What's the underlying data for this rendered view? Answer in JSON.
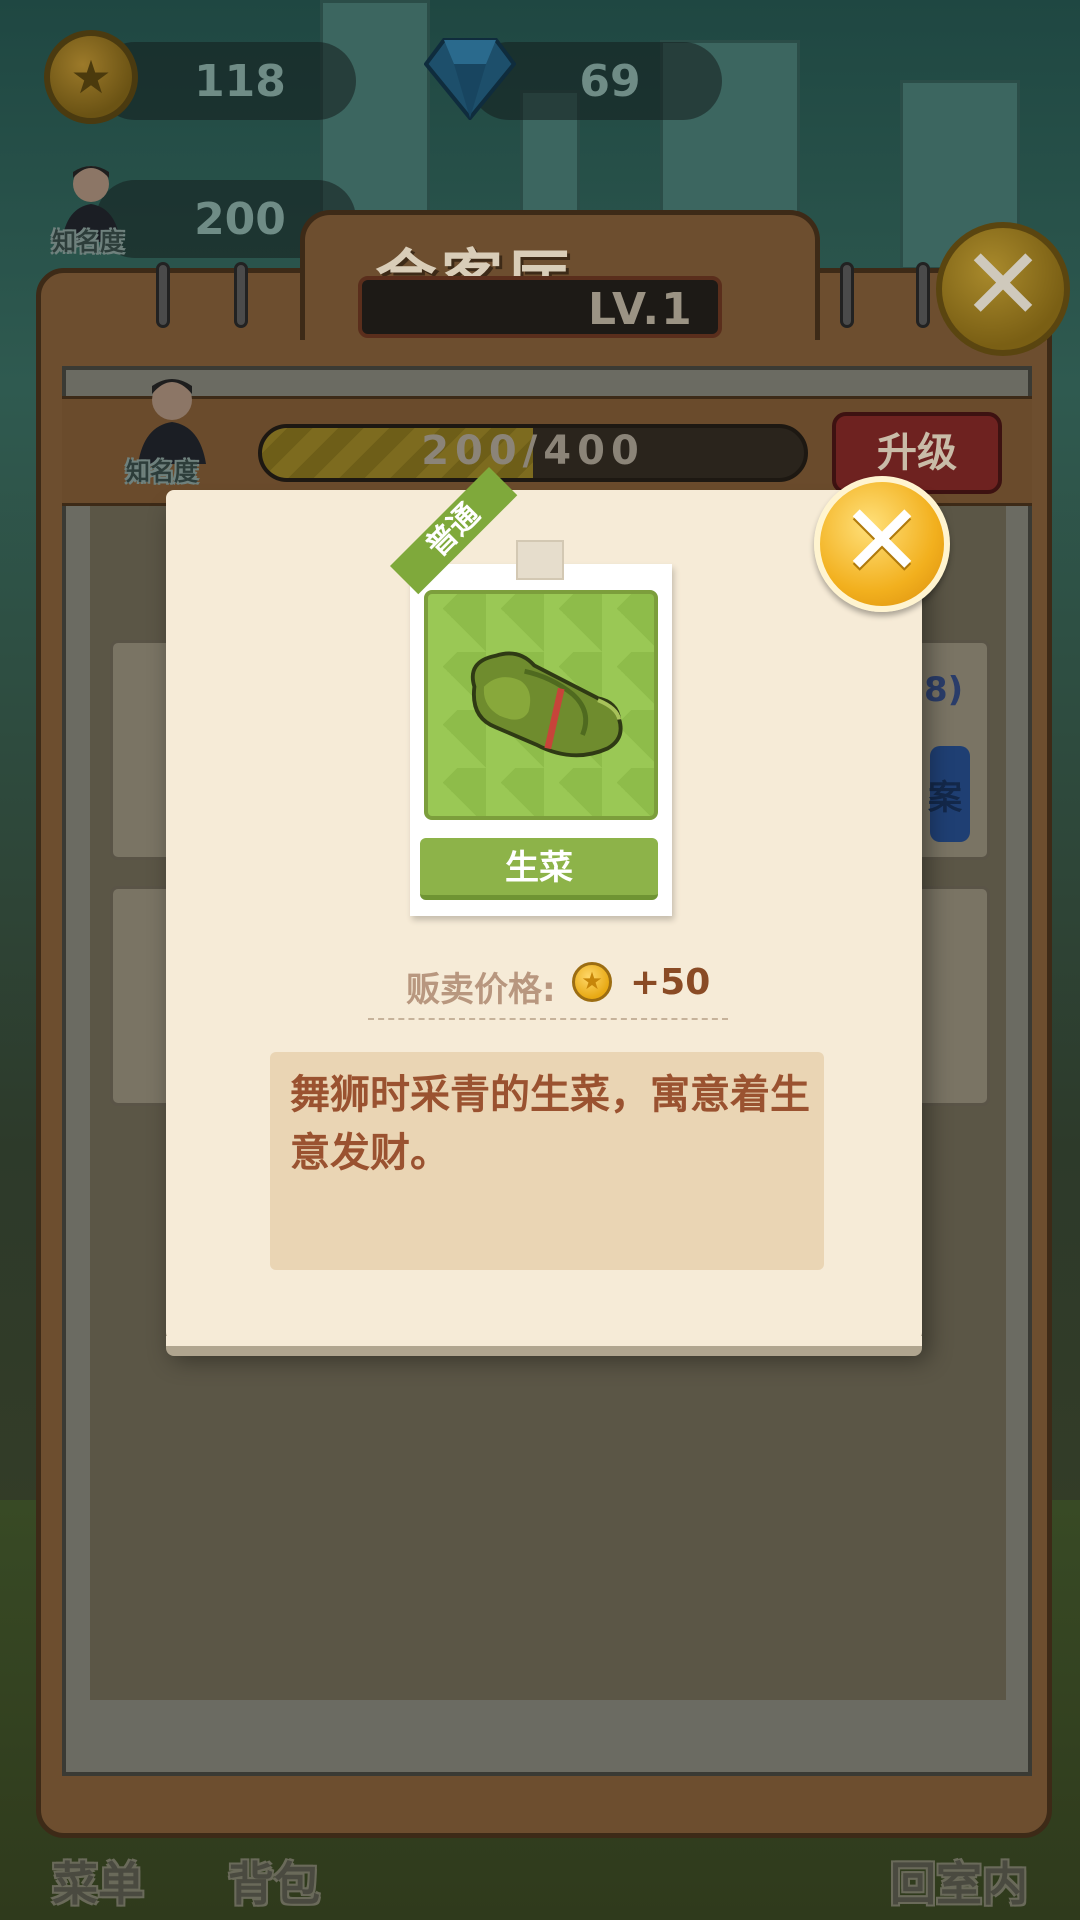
{
  "hud": {
    "coins": "118",
    "gems": "69",
    "fame_value": "200",
    "fame_label": "知名度"
  },
  "panel": {
    "title": "会客厅",
    "level": "LV.1",
    "fame_label": "知名度",
    "progress_text": "200/400",
    "progress_fraction": 0.5,
    "upgrade_label": "升级",
    "side_text_partial": "8)",
    "side_button_partial": "案"
  },
  "popup": {
    "rarity": "普通",
    "item_name": "生菜",
    "price_label": "贩卖价格:",
    "price_value": "+50",
    "description": "舞狮时采青的生菜，寓意着生意发财。"
  },
  "bottom_nav": {
    "menu": "菜单",
    "bag": "背包",
    "return": "回室内"
  },
  "icons": {
    "coin": "coin-icon",
    "gem": "gem-icon",
    "close": "close-icon",
    "lettuce": "lettuce-icon"
  },
  "colors": {
    "accent_gold": "#f2b01e",
    "item_green": "#8db349",
    "desc_text": "#9a5230",
    "upgrade_red": "#c8302c"
  }
}
